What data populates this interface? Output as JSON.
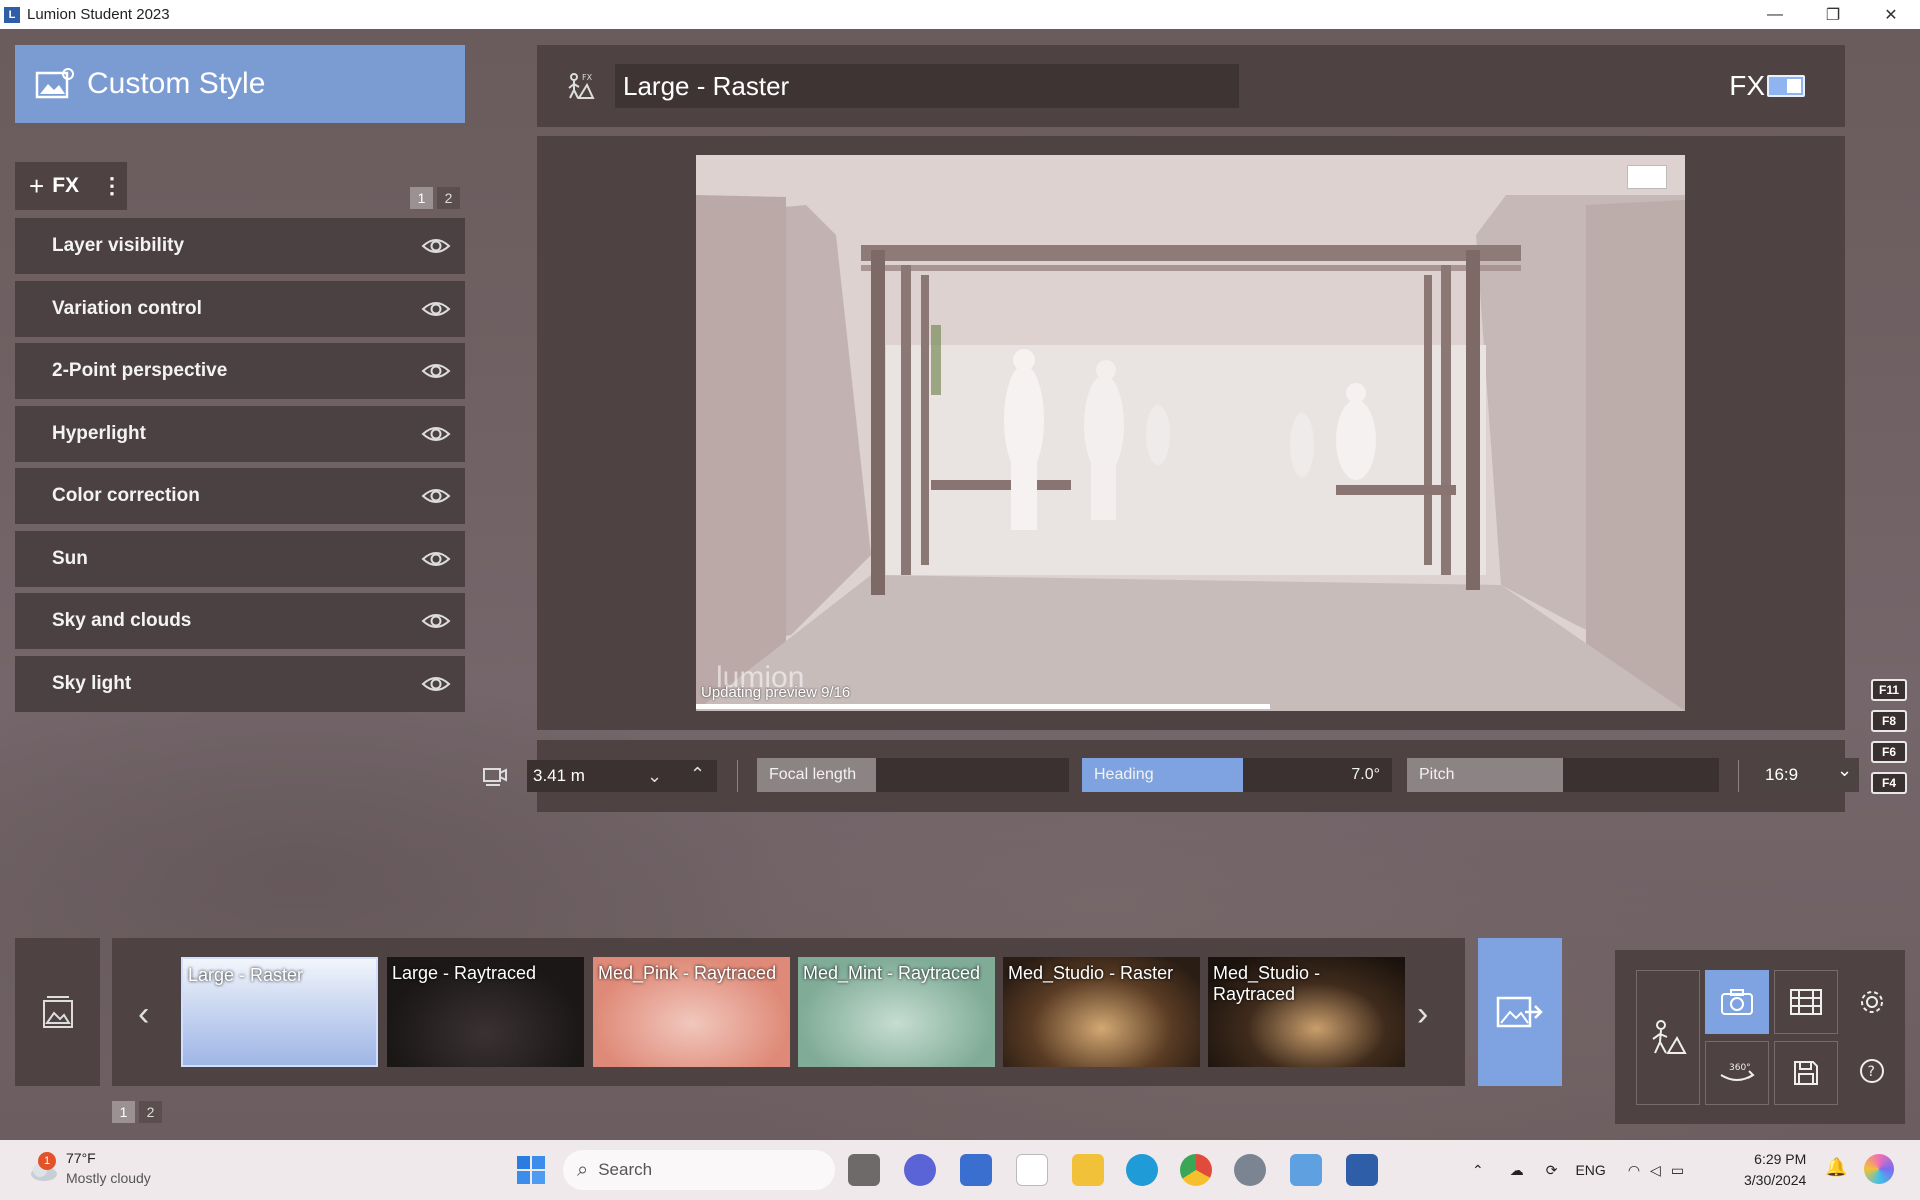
{
  "window": {
    "title": "Lumion Student 2023",
    "minimize": "—",
    "restore": "❐",
    "close": "✕"
  },
  "left_panel": {
    "title": "Custom Style",
    "add_fx_label": "FX",
    "page_tabs": [
      "1",
      "2"
    ],
    "fx_items": [
      {
        "label": "Layer visibility"
      },
      {
        "label": "Variation control"
      },
      {
        "label": "2-Point perspective"
      },
      {
        "label": "Hyperlight"
      },
      {
        "label": "Color correction"
      },
      {
        "label": "Sun"
      },
      {
        "label": "Sky and clouds"
      },
      {
        "label": "Sky light"
      }
    ]
  },
  "header": {
    "style_name": "Large - Raster",
    "fx_label": "FX",
    "fx_toggle_on": true
  },
  "preview": {
    "status": "Updating preview 9/16",
    "watermark": "lumion",
    "progress": 0.58
  },
  "camera_bar": {
    "distance": "3.41 m",
    "focal_length": {
      "label": "Focal length",
      "value": "",
      "fill": 0.38
    },
    "heading": {
      "label": "Heading",
      "value": "7.0°",
      "fill": 0.52
    },
    "pitch": {
      "label": "Pitch",
      "value": "",
      "fill": 0.5
    },
    "aspect_ratio": "16:9",
    "fkeys": [
      "F11",
      "F8",
      "F6",
      "F4"
    ]
  },
  "style_strip": {
    "thumbnails": [
      {
        "label": "Large - Raster",
        "selected": true
      },
      {
        "label": "Large - Raytraced",
        "selected": false
      },
      {
        "label": "Med_Pink - Raytraced",
        "selected": false
      },
      {
        "label": "Med_Mint - Raytraced",
        "selected": false
      },
      {
        "label": "Med_Studio - Raster",
        "selected": false
      },
      {
        "label": "Med_Studio - Raytraced",
        "selected": false
      }
    ],
    "page_tabs": [
      "1",
      "2"
    ]
  },
  "taskbar": {
    "weather_temp": "77°F",
    "weather_desc": "Mostly cloudy",
    "weather_badge": "1",
    "search_placeholder": "Search",
    "language": "ENG",
    "time": "6:29 PM",
    "date": "3/30/2024"
  },
  "colors": {
    "accent": "#7ea3e0",
    "panel": "#4e4243",
    "background": "#6b5c5d"
  }
}
